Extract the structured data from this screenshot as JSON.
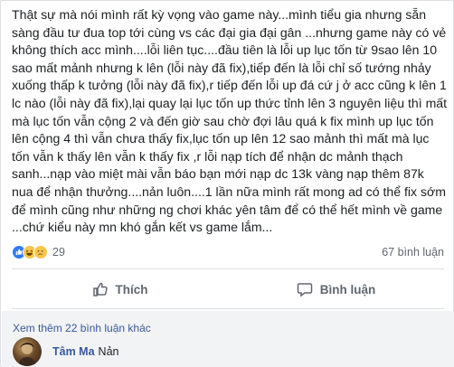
{
  "post": {
    "text": "Thật sự mà nói mình rất kỳ vọng vào game này...mình tiểu gia nhưng sẵn sàng đầu tư đua top tới cùng vs các đại gia đại gân ...nhưng game này có vẻ không thích acc mình....lỗi liên tục....đầu tiên là lỗi up lục tốn từ 9sao lên 10 sao mất mảnh nhưng k lên (lỗi này đã fix),tiếp đến là lỗi chỉ số tướng nhảy xuống thấp k tưởng (lỗi này đã fix),r tiếp đến lỗi up đá cứ j ở acc cũng k lên 1 lc nào (lỗi này đã fix),lại quay lại lục tốn up thức tỉnh lên 3 nguyên liệu thì mất mà lục tốn vẫn cộng 2 và đến giờ sau chờ đợi lâu quá k fix mình up lục tốn lên cộng 4 thì vẫn chưa thấy fix,lục tốn up lên 12 sao mảnh thì mất mà lục tốn vẫn k thấy lên vẫn k thấy fix ,r lỗi nạp tích để nhận dc mảnh thạch sanh...nạp vào miệt mài vẫn báo bạn mới nạp dc 13k vàng nạp thêm 87k nua để nhận thưởng....nản luôn....1 lần nữa mình rất mong ad có thể fix sớm để mình cũng như những ng chơi khác yên tâm để có thể hết mình về game ...chứ kiểu này mn khó gắn kết vs game lắm..."
  },
  "reactions": {
    "icons": [
      "like-icon",
      "haha-icon",
      "sad-icon"
    ],
    "count": "29",
    "comments": "67 bình luận"
  },
  "actions": {
    "like_label": "Thích",
    "comment_label": "Bình luận"
  },
  "comments": {
    "more_label": "Xem thêm 22 bình luận khác",
    "items": [
      {
        "author": "Tâm Ma",
        "text": "Nản"
      }
    ]
  },
  "colors": {
    "like_blue": "#2e7cf6",
    "emoji_yellow": "#f7c64d",
    "link_blue": "#385898",
    "muted_gray": "#606770"
  }
}
